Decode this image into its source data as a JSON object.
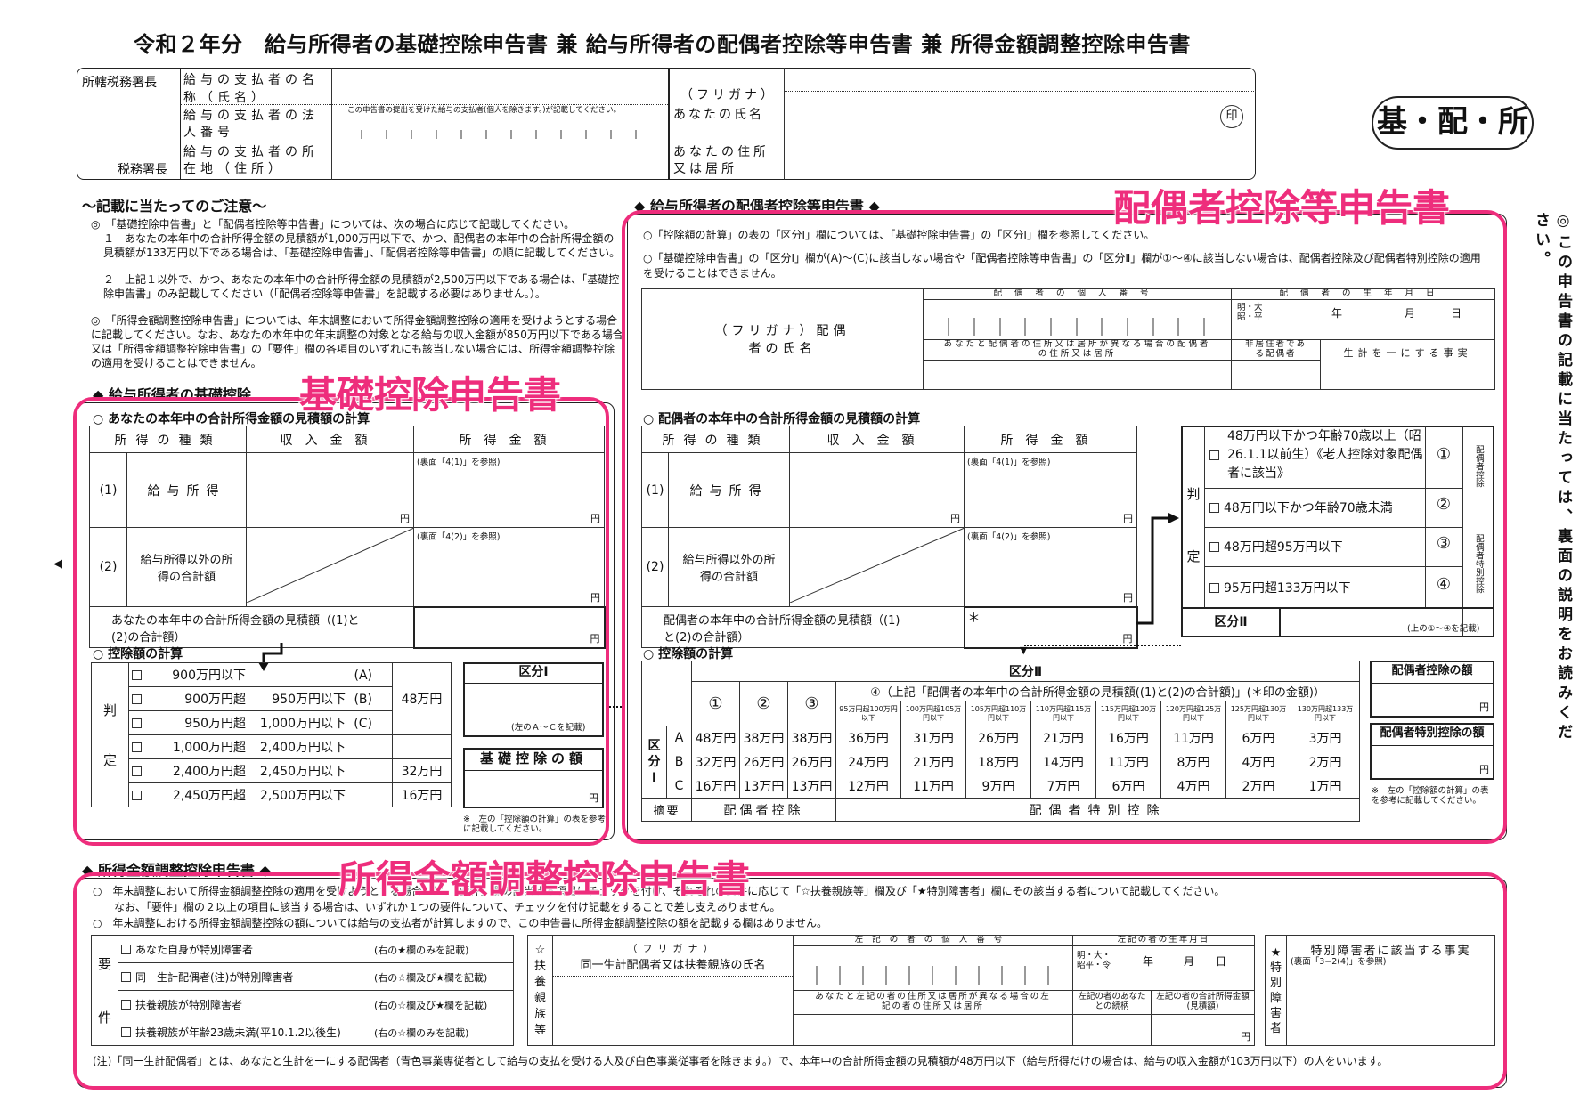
{
  "title": "令和２年分　給与所得者の基礎控除申告書 兼 給与所得者の配偶者控除等申告書 兼 所得金額調整控除申告書",
  "stamp": "基・配・所",
  "seal": "印",
  "header": {
    "office": "所轄税務署長",
    "office_suffix": "税務署長",
    "payer_name": "給与の支払者の名称（氏名）",
    "payer_no": "給与の支払者の法人番号",
    "payer_no_note": "この申告書の提出を受けた給与の支払者(個人を除きます。)が記載してください。",
    "payer_addr": "給与の支払者の所在地（住所）",
    "furigana": "（フリガナ）",
    "your_name": "あなたの氏名",
    "your_addr": "あなたの住所又は居所"
  },
  "notes": {
    "heading": "〜記載に当たってのご注意〜",
    "lines": [
      "◎　「基礎控除申告書」と「配偶者控除等申告書」については、次の場合に応じて記載してください。",
      "１　あなたの本年中の合計所得金額の見積額が1,000万円以下で、かつ、配偶者の本年中の合計所得金額の見積額が133万円以下である場合は、「基礎控除申告書」、「配偶者控除等申告書」の順に記載してください。",
      "２　上記１以外で、かつ、あなたの本年中の合計所得金額の見積額が2,500万円以下である場合は、「基礎控除申告書」のみ記載してください（「配偶者控除等申告書」を記載する必要はありません。）。",
      "◎　「所得金額調整控除申告書」については、年末調整において所得金額調整控除の適用を受けようとする場合に記載してください。なお、あなたの本年中の年末調整の対象となる給与の収入金額が850万円以下である場合又は「所得金額調整控除申告書」の「要件」欄の各項目のいずれにも該当しない場合には、所得金額調整控除の適用を受けることはできません。"
    ]
  },
  "side_note": "◎この申告書の記載に当たっては、裏面の説明をお読みください。",
  "left_arrow": "◀",
  "kiso": {
    "heading": "◆ 給与所得者の基礎控除",
    "overlay": "基礎控除申告書",
    "calc_title": "○ あなたの本年中の合計所得金額の見積額の計算",
    "cols": [
      "所得の種類",
      "収入金額",
      "所得金額"
    ],
    "rows": [
      {
        "no": "(1)",
        "label": "給与所得",
        "ref": "(裏面「4(1)」を参照)"
      },
      {
        "no": "(2)",
        "label": "給与所得以外の所得の合計額",
        "ref": "(裏面「4(2)」を参照)"
      }
    ],
    "total_label": "あなたの本年中の合計所得金額の見積額（(1)と(2)の合計額）",
    "yen": "円",
    "deduct_title": "○ 控除額の計算",
    "judge": [
      "判",
      "定"
    ],
    "brackets": [
      {
        "from": "900万円以下",
        "to": "",
        "code": "(A)"
      },
      {
        "from": "900万円超",
        "to": "950万円以下",
        "code": "(B)"
      },
      {
        "from": "950万円超",
        "to": "1,000万円以下",
        "code": "(C)"
      },
      {
        "from": "1,000万円超",
        "to": "2,400万円以下",
        "code": ""
      },
      {
        "from": "2,400万円超",
        "to": "2,450万円以下",
        "code": ""
      },
      {
        "from": "2,450万円超",
        "to": "2,500万円以下",
        "code": ""
      }
    ],
    "amounts": [
      "48万円",
      "32万円",
      "16万円"
    ],
    "kubun_label": "区分Ⅰ",
    "kubun_note": "(左のＡ〜Ｃを記載)",
    "amount_label": "基礎控除の額",
    "foot": "※　左の「控除額の計算」の表を参考に記載してください。"
  },
  "haigu": {
    "heading": "◆ 給与所得者の配偶者控除等申告書 ◆",
    "overlay": "配偶者控除等申告書",
    "notes": [
      "○「控除額の計算」の表の「区分Ⅰ」欄については、「基礎控除申告書」の「区分Ⅰ」欄を参照してください。",
      "○「基礎控除申告書」の「区分Ⅰ」欄が(A)〜(C)に該当しない場合や「配偶者控除等申告書」の「区分Ⅱ」欄が①〜④に該当しない場合は、配偶者控除及び配偶者特別控除の適用を受けることはできません。"
    ],
    "spouse_name": "（フリガナ）配偶者の氏名",
    "spouse_no": "配偶者の個人番号",
    "spouse_birth": "配偶者の生年月日",
    "era": "明・大昭・平",
    "ymd": [
      "年",
      "月",
      "日"
    ],
    "spouse_addr": "あなたと配偶者の住所又は居所が異なる場合の配偶者の住所又は居所",
    "nonresident": "非居住者である配偶者",
    "same_living": "生計を一にする事実",
    "calc_title": "○ 配偶者の本年中の合計所得金額の見積額の計算",
    "cols": [
      "所得の種類",
      "収入金額",
      "所得金額"
    ],
    "rows": [
      {
        "no": "(1)",
        "label": "給与所得",
        "ref": "(裏面「4(1)」を参照)"
      },
      {
        "no": "(2)",
        "label": "給与所得以外の所得の合計額",
        "ref": "(裏面「4(2)」を参照)"
      }
    ],
    "total_label": "配偶者の本年中の合計所得金額の見積額（(1)と(2)の合計額）",
    "star": "＊",
    "judge": [
      "判",
      "定"
    ],
    "conds": [
      {
        "text": "48万円以下かつ年齢70歳以上（昭26.1.1以前生）《老人控除対象配偶者に該当》",
        "no": "①"
      },
      {
        "text": "48万円以下かつ年齢70歳未満",
        "no": "②"
      },
      {
        "text": "48万円超95万円以下",
        "no": "③"
      },
      {
        "text": "95万円超133万円以下",
        "no": "④"
      }
    ],
    "side1": "配偶者控除",
    "side2": "配偶者特別控除",
    "kubun2": "区分Ⅱ",
    "kubun2_note": "(上の①〜④を記載)",
    "deduct_title": "○ 控除額の計算",
    "grid_head": "区分Ⅱ",
    "grid_sub": "④（上記「配偶者の本年中の合計所得金額の見積額((1)と(2)の合計額)」(＊印の金額)）",
    "col_nos": [
      "①",
      "②",
      "③"
    ],
    "ranges": [
      "95万円超100万円以下",
      "100万円超105万円以下",
      "105万円超110万円以下",
      "110万円超115万円以下",
      "115万円超120万円以下",
      "120万円超125万円以下",
      "125万円超130万円以下",
      "130万円超133万円以下"
    ],
    "kubun1": "区分Ⅰ",
    "grid": [
      {
        "row": "A",
        "vals": [
          "48万円",
          "38万円",
          "38万円",
          "36万円",
          "31万円",
          "26万円",
          "21万円",
          "16万円",
          "11万円",
          "6万円",
          "3万円"
        ]
      },
      {
        "row": "B",
        "vals": [
          "32万円",
          "26万円",
          "26万円",
          "24万円",
          "21万円",
          "18万円",
          "14万円",
          "11万円",
          "8万円",
          "4万円",
          "2万円"
        ]
      },
      {
        "row": "C",
        "vals": [
          "16万円",
          "13万円",
          "13万円",
          "12万円",
          "11万円",
          "9万円",
          "7万円",
          "6万円",
          "4万円",
          "2万円",
          "1万円"
        ]
      }
    ],
    "summary": [
      "摘要",
      "配偶者控除",
      "配偶者特別控除"
    ],
    "ded1": "配偶者控除の額",
    "ded2": "配偶者特別控除の額",
    "foot": "※　左の「控除額の計算」の表を参考に記載してください。"
  },
  "shotoku": {
    "heading": "◆ 所得金額調整控除申告書 ◆",
    "overlay": "所得金額調整控除申告書",
    "notes": [
      "○　年末調整において所得金額調整控除の適用を受けようとする場合には、「要件」欄の該当する項目にチェックを付け、それぞれの要件に応じて「☆扶養親族等」欄及び「★特別障害者」欄にその該当する者について記載してください。",
      "なお、「要件」欄の２以上の項目に該当する場合は、いずれか１つの要件について、チェックを付け記載をすることで差し支えありません。",
      "○　年末調整における所得金額調整控除の額については給与の支払者が計算しますので、この申告書に所得金額調整控除の額を記載する欄はありません。"
    ],
    "req": "要件",
    "items": [
      {
        "t": "あなた自身が特別障害者",
        "r": "(右の★欄のみを記載)"
      },
      {
        "t": "同一生計配偶者(注)が特別障害者",
        "r": "(右の☆欄及び★欄を記載)"
      },
      {
        "t": "扶養親族が特別障害者",
        "r": "(右の☆欄及び★欄を記載)"
      },
      {
        "t": "扶養親族が年齢23歳未満(平10.1.2以後生)",
        "r": "(右の☆欄のみを記載)"
      }
    ],
    "fuyo": "☆扶養親族等",
    "furigana": "（フリガナ）",
    "fam_name": "同一生計配偶者又は扶養親族の氏名",
    "fam_no": "左記の者の個人番号",
    "fam_birth": "左記の者の生年月日",
    "era": "明・大・昭平・令",
    "fam_addr": "あなたと左記の者の住所又は居所が異なる場合の左記の者の住所又は居所",
    "rel": "左記の者のあなたとの続柄",
    "income": "左記の者の合計所得金額(見積額)",
    "yen": "円",
    "special": "★特別障害者",
    "special_fact": "特別障害者に該当する事実",
    "special_ref": "(裏面「3−2(4)」を参照)",
    "footnote": "(注)「同一生計配偶者」とは、あなたと生計を一にする配偶者（青色事業専従者として給与の支払を受ける人及び白色事業従事者を除きます。）で、本年中の合計所得金額の見積額が48万円以下（給与所得だけの場合は、給与の収入金額が103万円以下）の人をいいます。"
  }
}
